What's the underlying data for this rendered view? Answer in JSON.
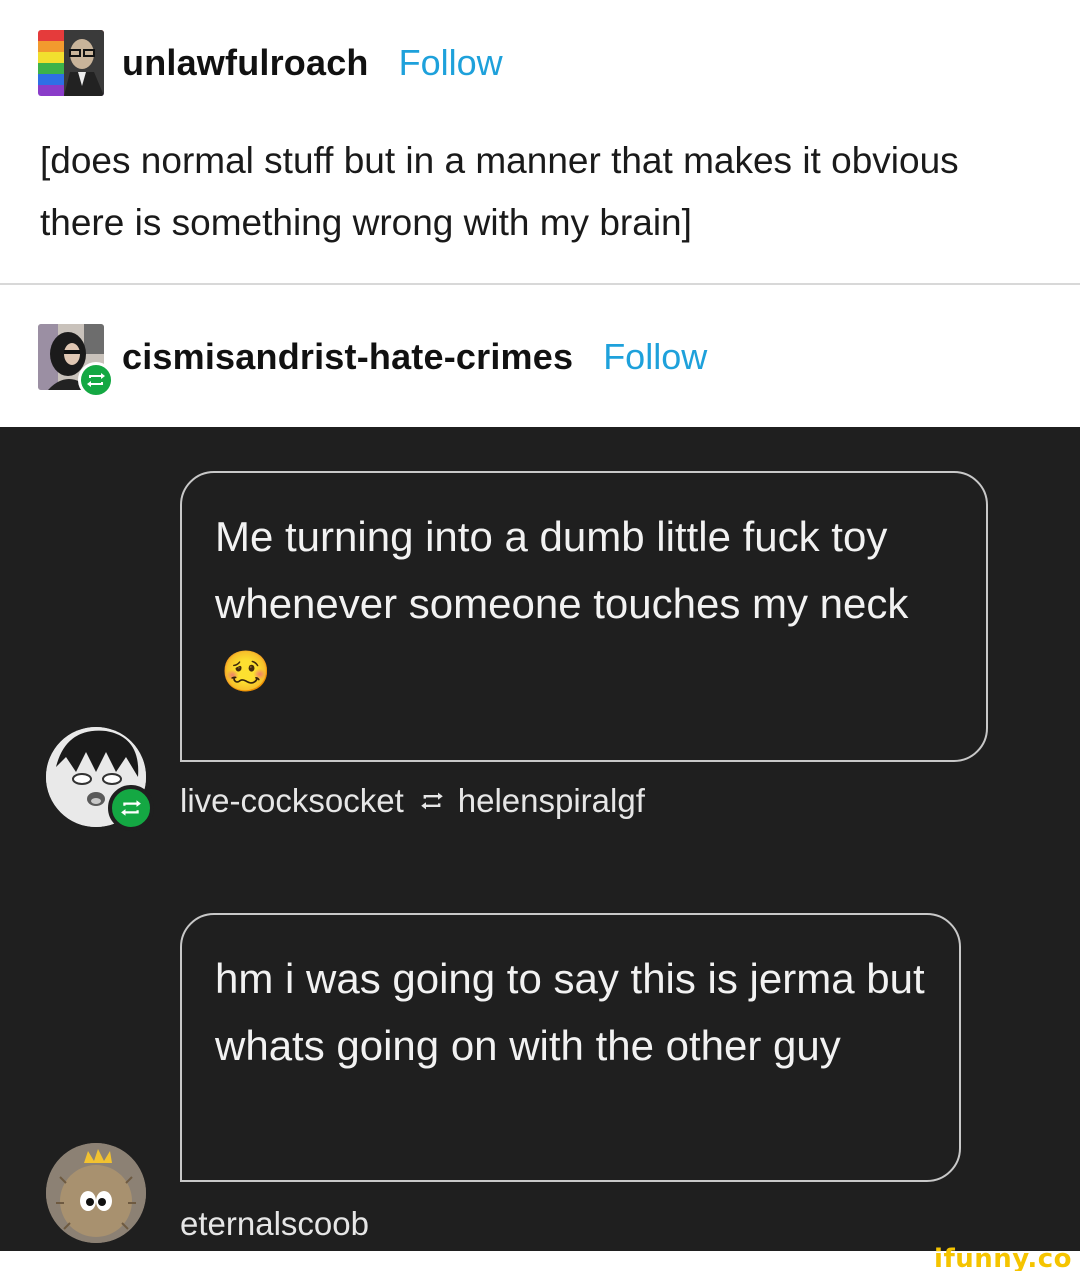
{
  "post": {
    "username": "unlawfulroach",
    "follow_label": "Follow",
    "text": "[does normal stuff but in a manner that makes it obvious there is something wrong with my brain]"
  },
  "reblog": {
    "username": "cismisandrist-hate-crimes",
    "follow_label": "Follow"
  },
  "screenshot": {
    "messages": [
      {
        "text": "Me turning into a dumb little fuck toy whenever someone touches my neck",
        "emoji": "🥴",
        "author": "live-cocksocket",
        "reblogged_from": "helenspiralgf"
      },
      {
        "text": "hm i was going to say this is jerma but whats going on with the other guy",
        "author": "eternalscoob"
      }
    ]
  },
  "watermark": "ifunny.co",
  "colors": {
    "follow": "#1ea1db",
    "reblog_green": "#14a843",
    "dark_bg": "#1f1f1f",
    "watermark": "#f5c400"
  },
  "icons": [
    "reblog-icon",
    "avatar-unlawfulroach",
    "avatar-cismisandrist",
    "avatar-live-cocksocket",
    "avatar-eternalscoob"
  ]
}
